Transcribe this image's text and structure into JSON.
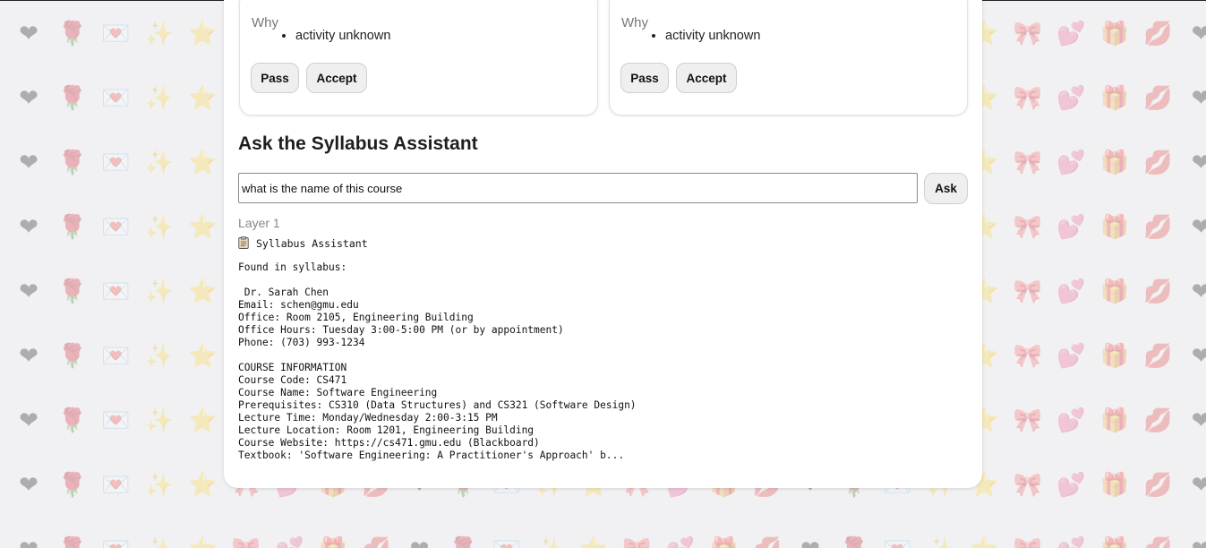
{
  "background": {
    "color": "#f1f1f3",
    "pattern": [
      "❤",
      "🌹",
      "💌",
      "✨",
      "⭐",
      "🎀",
      "💕",
      "🎁",
      "💋"
    ]
  },
  "cards": [
    {
      "why_label": "Why",
      "reasons": [
        "activity unknown"
      ],
      "pass_label": "Pass",
      "accept_label": "Accept"
    },
    {
      "why_label": "Why",
      "reasons": [
        "activity unknown"
      ],
      "pass_label": "Pass",
      "accept_label": "Accept"
    }
  ],
  "assistant": {
    "title": "Ask the Syllabus Assistant",
    "query_value": "what is the name of this course",
    "ask_label": "Ask",
    "layer_label": "Layer 1",
    "icon": "clipboard-icon",
    "header": "Syllabus Assistant",
    "response_lines": [
      "Found in syllabus:",
      "",
      " Dr. Sarah Chen",
      "Email: schen@gmu.edu",
      "Office: Room 2105, Engineering Building",
      "Office Hours: Tuesday 3:00-5:00 PM (or by appointment)",
      "Phone: (703) 993-1234",
      "",
      "COURSE INFORMATION",
      "Course Code: CS471",
      "Course Name: Software Engineering",
      "Prerequisites: CS310 (Data Structures) and CS321 (Software Design)",
      "Lecture Time: Monday/Wednesday 2:00-3:15 PM",
      "Lecture Location: Room 1201, Engineering Building",
      "Course Website: https://cs471.gmu.edu (Blackboard)",
      "Textbook: 'Software Engineering: A Practitioner's Approach' b..."
    ]
  }
}
